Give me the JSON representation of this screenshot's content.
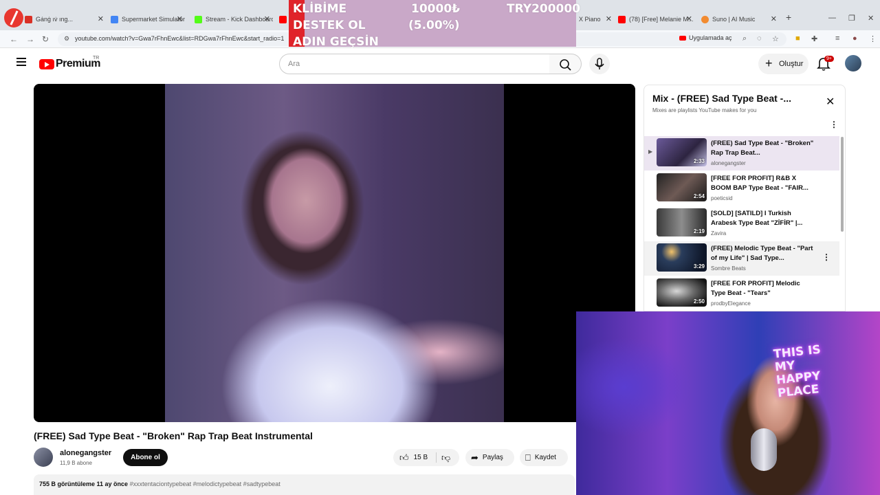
{
  "browser": {
    "tabs": [
      {
        "title": "Gȧnġ ıv̇ ıng...",
        "favicon_color": "#d93025"
      },
      {
        "title": "Supermarket Simulator",
        "favicon_color": "#4285f4"
      },
      {
        "title": "Stream - Kick Dashboard",
        "favicon_color": "#53fc18"
      },
      {
        "title": "",
        "favicon_color": "#ff0000"
      },
      {
        "title": "X Piano",
        "favicon_color": "#ff0000"
      },
      {
        "title": "(78) [Free] Melanie M...",
        "favicon_color": "#ff0000"
      },
      {
        "title": "Suno | AI Music",
        "favicon_color": "#f28b30"
      }
    ],
    "url": "youtube.com/watch?v=Gwa7rFhnEwc&list=RDGwa7rFhnEwc&start_radio=1",
    "open_in_app": "Uygulamada aç"
  },
  "donation": {
    "line1": "KLİBİME",
    "line2": "DESTEK OL",
    "line3": "ADIN GEÇSİN",
    "current": "10000₺",
    "percent": "(5.00%)",
    "goal": "TRY200000"
  },
  "header": {
    "brand": "Premium",
    "region": "TR",
    "search_placeholder": "Ara",
    "create_label": "Oluştur",
    "notification_badge": "9+"
  },
  "video": {
    "title": "(FREE) Sad Type Beat - \"Broken\" Rap Trap Beat Instrumental",
    "channel": "alonegangster",
    "subscribers": "11,9 B abone",
    "subscribe_label": "Abone ol",
    "likes": "15 B",
    "share_label": "Paylaş",
    "save_label": "Kaydet",
    "views": "755 B görüntüleme  11 ay önce",
    "hashtags": "#xxxtentaciontypebeat #melodictypebeat #sadtypebeat"
  },
  "playlist": {
    "title": "Mix - (FREE) Sad Type Beat -...",
    "subtitle": "Mixes are playlists YouTube makes for you",
    "items": [
      {
        "title": "(FREE) Sad Type Beat - \"Broken\" Rap Trap Beat...",
        "channel": "alonegangster",
        "duration": "2:33"
      },
      {
        "title": "[FREE FOR PROFIT] R&B X BOOM BAP Type Beat - \"FAIR...",
        "channel": "poeticsid",
        "duration": "2:54"
      },
      {
        "title": "[SOLD] [SATILD] I Turkish Arabesk Type Beat \"ZİFİR\" |...",
        "channel": "Zavira",
        "duration": "2:19"
      },
      {
        "title": "(FREE) Melodic Type Beat - \"Part of my Life\" | Sad Type...",
        "channel": "Sombre Beats",
        "duration": "3:29"
      },
      {
        "title": "[FREE FOR PROFIT] Melodic Type Beat - \"Tears\"",
        "channel": "prodbyElegance",
        "duration": "2:50"
      }
    ]
  },
  "webcam": {
    "neon_sign": "THIS IS MY HAPPY PLACE"
  },
  "colors": {
    "youtube_red": "#ff0000",
    "donation_bg": "#c9a8c8",
    "donation_accent": "#e0232a",
    "active_row": "#ece5f1"
  }
}
